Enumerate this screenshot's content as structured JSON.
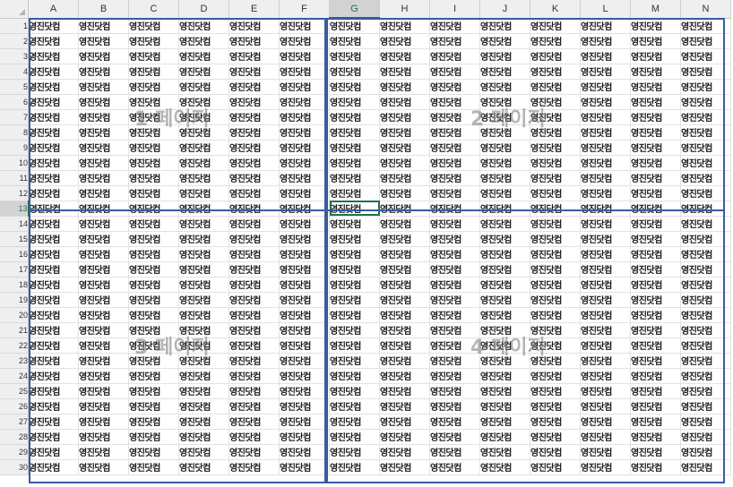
{
  "sheet": {
    "columns": [
      "A",
      "B",
      "C",
      "D",
      "E",
      "F",
      "G",
      "H",
      "I",
      "J",
      "K",
      "L",
      "M",
      "N"
    ],
    "rows": [
      "1",
      "2",
      "3",
      "4",
      "5",
      "6",
      "7",
      "8",
      "9",
      "10",
      "11",
      "12",
      "13",
      "14",
      "15",
      "16",
      "17",
      "18",
      "19",
      "20",
      "21",
      "22",
      "23",
      "24",
      "25",
      "26",
      "27",
      "28",
      "29",
      "30"
    ],
    "cell_text": "영진닷컴",
    "selected_column": "G",
    "selected_row": "13",
    "active_cell": "G13"
  },
  "page_break_preview": {
    "pages": [
      "1 페이지",
      "2 페이지",
      "3 페이지",
      "4 페이지"
    ]
  },
  "colors": {
    "header_bg": "#efefef",
    "selection_accent": "#217346",
    "page_border": "#3b5aa0"
  }
}
